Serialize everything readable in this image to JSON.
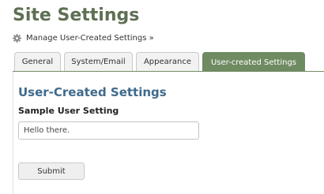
{
  "header": {
    "title": "Site Settings",
    "manage_link": "Manage User-Created Settings »",
    "manage_icon": "gear-icon"
  },
  "tabs": [
    {
      "label": "General",
      "active": false
    },
    {
      "label": "System/Email",
      "active": false
    },
    {
      "label": "Appearance",
      "active": false
    },
    {
      "label": "User-created Settings",
      "active": true
    }
  ],
  "section": {
    "heading": "User-Created Settings",
    "field_label": "Sample User Setting",
    "field_value": "Hello there.",
    "submit_label": "Submit"
  },
  "colors": {
    "title": "#5e6f53",
    "active_tab": "#6f8b61",
    "heading": "#3f6a8c"
  }
}
